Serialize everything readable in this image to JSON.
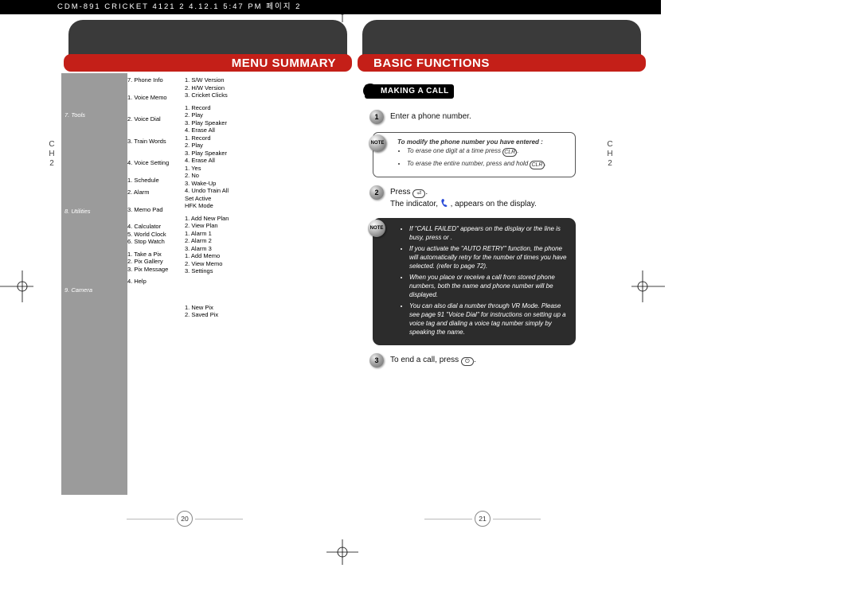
{
  "header": {
    "raw": "CDM-891  CRICKET  4121  2  4.12.1  5:47 PM 페이지 2"
  },
  "chapter_label": "CH 2",
  "left_page": {
    "title": "MENU SUMMARY",
    "page_number": "20",
    "sections": [
      "7. Tools",
      "8. Utilities",
      "9. Camera"
    ],
    "col1": [
      "7. Phone Info",
      "",
      "",
      "1. Voice Memo",
      "",
      "",
      "",
      "2. Voice Dial",
      "",
      "",
      "",
      "3. Train Words",
      "",
      "",
      "",
      "4. Voice Setting",
      "",
      "",
      "1. Schedule",
      "",
      "2. Alarm",
      "",
      "",
      "3. Memo Pad",
      "",
      "",
      "4. Calculator",
      "5. World Clock",
      "6. Stop Watch",
      "",
      "1. Take a Pix",
      "2. Pix Gallery",
      "3. Pix Message",
      "",
      "4. Help"
    ],
    "col2": [
      "1. S/W Version",
      "2. H/W Version",
      "3. Cricket Clicks",
      "",
      "1. Record",
      "2. Play",
      "3. Play Speaker",
      "4. Erase All",
      "1. Record",
      "2. Play",
      "3. Play Speaker",
      "4. Erase All",
      "1. Yes",
      "2. No",
      "3. Wake-Up",
      "4. Undo Train All",
      "Set Active",
      "HFK Mode",
      "",
      "1. Add New Plan",
      "2. View Plan",
      "1. Alarm 1",
      "2. Alarm 2",
      "3. Alarm 3",
      "1. Add Memo",
      "2. View Memo",
      "3. Settings",
      "",
      "",
      "",
      "",
      "",
      "",
      "1. New Pix",
      "2. Saved Pix"
    ]
  },
  "right_page": {
    "title": "BASIC FUNCTIONS",
    "page_number": "21",
    "section_title": "MAKING A CALL",
    "step1": "Enter a phone number.",
    "note1_title": "To modify the phone number you have entered :",
    "note1_items": [
      "To erase one digit at a time press",
      "To erase the entire number, press and hold"
    ],
    "step2a": "Press",
    "step2b": "The indicator,",
    "step2c": ", appears on the display.",
    "note2_items": [
      "If \"CALL FAILED\" appears on the display or the line is busy, press       or       .",
      "If you activate the \"AUTO RETRY\" function, the phone will automatically retry for the number of times you have selected. (refer to page 72).",
      "When you place or receive a call from stored phone numbers, both the name and phone number will be displayed.",
      "You can also dial a number through VR Mode.  Please see page 91 \"Voice Dial\" for instructions on setting up a voice tag and dialing a voice tag number simply by speaking the name."
    ],
    "step3": "To end a call, press",
    "note_label": "NOTE"
  }
}
